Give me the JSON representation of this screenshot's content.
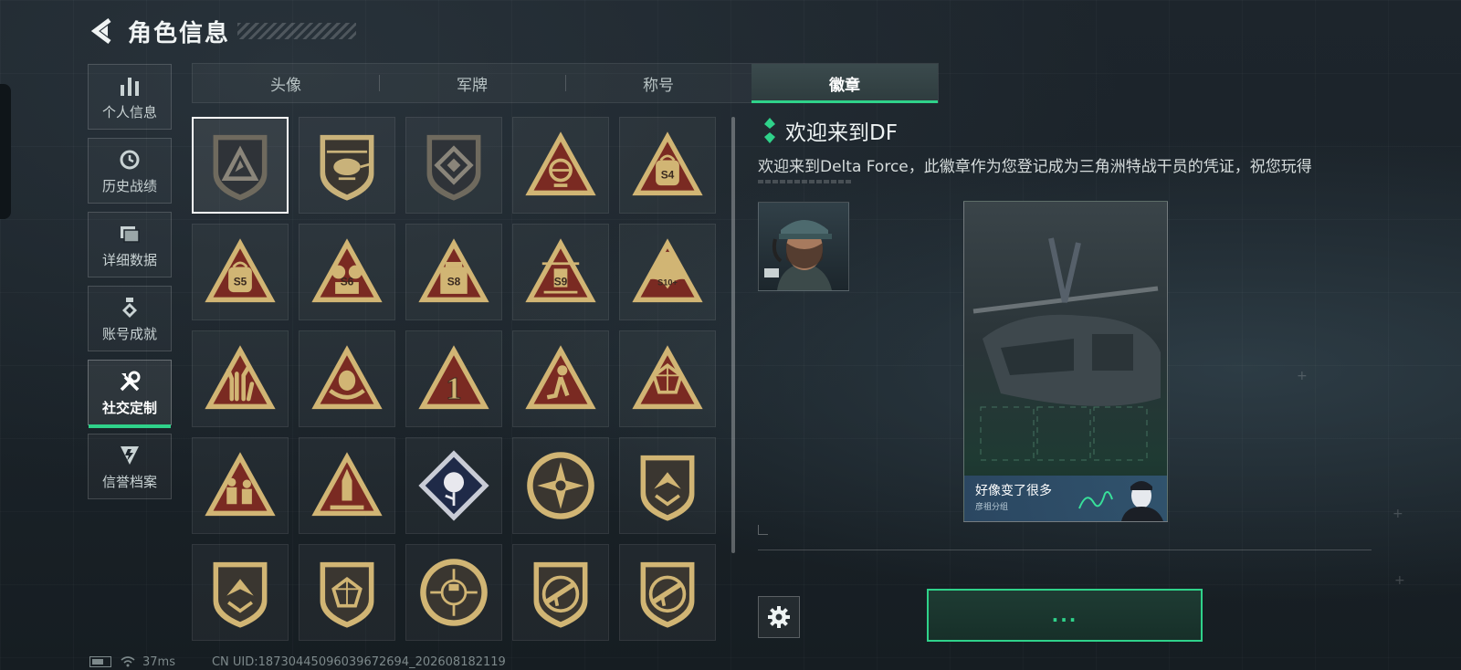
{
  "header": {
    "title": "角色信息"
  },
  "sidebar": {
    "items": [
      {
        "label": "个人信息",
        "icon": "bar-chart-icon",
        "active": false
      },
      {
        "label": "历史战绩",
        "icon": "history-clock-icon",
        "active": false
      },
      {
        "label": "详细数据",
        "icon": "folder-data-icon",
        "active": false
      },
      {
        "label": "账号成就",
        "icon": "achievement-medal-icon",
        "active": false
      },
      {
        "label": "社交定制",
        "icon": "wrench-tools-icon",
        "active": true
      },
      {
        "label": "信誉档案",
        "icon": "shield-emblem-icon",
        "active": false
      }
    ]
  },
  "tabs": [
    {
      "label": "头像",
      "active": false
    },
    {
      "label": "军牌",
      "active": false
    },
    {
      "label": "称号",
      "active": false
    },
    {
      "label": "徽章",
      "active": true
    }
  ],
  "badges": [
    {
      "shape": "shield",
      "label": "",
      "motif": "delta",
      "color": "#6f6a5e",
      "selected": true
    },
    {
      "shape": "shield",
      "label": "",
      "motif": "helicopter",
      "color": "#c9b27a"
    },
    {
      "shape": "shield",
      "label": "",
      "motif": "diamond",
      "color": "#6f6a5e"
    },
    {
      "shape": "triangle",
      "label": "",
      "motif": "globe",
      "color": "#d1b574"
    },
    {
      "shape": "triangle",
      "label": "S4",
      "motif": "bag",
      "color": "#d1b574"
    },
    {
      "shape": "triangle",
      "label": "S5",
      "motif": "bag",
      "color": "#d1b574"
    },
    {
      "shape": "triangle",
      "label": "S6",
      "motif": "reels",
      "color": "#d1b574"
    },
    {
      "shape": "triangle",
      "label": "S8",
      "motif": "box",
      "color": "#d1b574"
    },
    {
      "shape": "triangle",
      "label": "S9",
      "motif": "drone",
      "color": "#d1b574"
    },
    {
      "shape": "triangle",
      "label": "S10+",
      "motif": "phoenix",
      "color": "#d1b574"
    },
    {
      "shape": "triangle",
      "label": "",
      "motif": "hand",
      "color": "#d1b574"
    },
    {
      "shape": "triangle",
      "label": "",
      "motif": "egg",
      "color": "#d1b574"
    },
    {
      "shape": "triangle",
      "label": "1",
      "motif": "number",
      "color": "#d1b574"
    },
    {
      "shape": "triangle",
      "label": "",
      "motif": "figure",
      "color": "#d1b574"
    },
    {
      "shape": "triangle",
      "label": "",
      "motif": "gem",
      "color": "#d1b574"
    },
    {
      "shape": "triangle",
      "label": "",
      "motif": "squad",
      "color": "#d1b574"
    },
    {
      "shape": "triangle",
      "label": "",
      "motif": "rocket",
      "color": "#d1b574"
    },
    {
      "shape": "diamond",
      "label": "",
      "motif": "rose",
      "color": "#c9ccd6"
    },
    {
      "shape": "circle",
      "label": "",
      "motif": "star",
      "color": "#d1b574"
    },
    {
      "shape": "shield",
      "label": "",
      "motif": "wings",
      "color": "#d1b574"
    },
    {
      "shape": "shield",
      "label": "",
      "motif": "arrow",
      "color": "#d1b574"
    },
    {
      "shape": "shield",
      "label": "",
      "motif": "gem",
      "color": "#d1b574"
    },
    {
      "shape": "circle",
      "label": "",
      "motif": "crosshair",
      "color": "#d1b574"
    },
    {
      "shape": "shield",
      "label": "",
      "motif": "rifle",
      "color": "#d1b574"
    },
    {
      "shape": "shield",
      "label": "",
      "motif": "smg",
      "color": "#d1b574"
    }
  ],
  "detail": {
    "title": "欢迎来到DF",
    "description": "欢迎来到Delta Force，此徽章作为您登记成为三角洲特战干员的凭证，祝您玩得",
    "card_name": "好像变了很多",
    "card_sub": "彦祖分组"
  },
  "actions": {
    "confirm_label": "..."
  },
  "status": {
    "ping": "37ms",
    "uid": "CN UID:18730445096039672694_202608182119"
  },
  "colors": {
    "accent": "#2fd28a",
    "badge_gold": "#d1b574",
    "badge_red": "#7a2a22"
  }
}
